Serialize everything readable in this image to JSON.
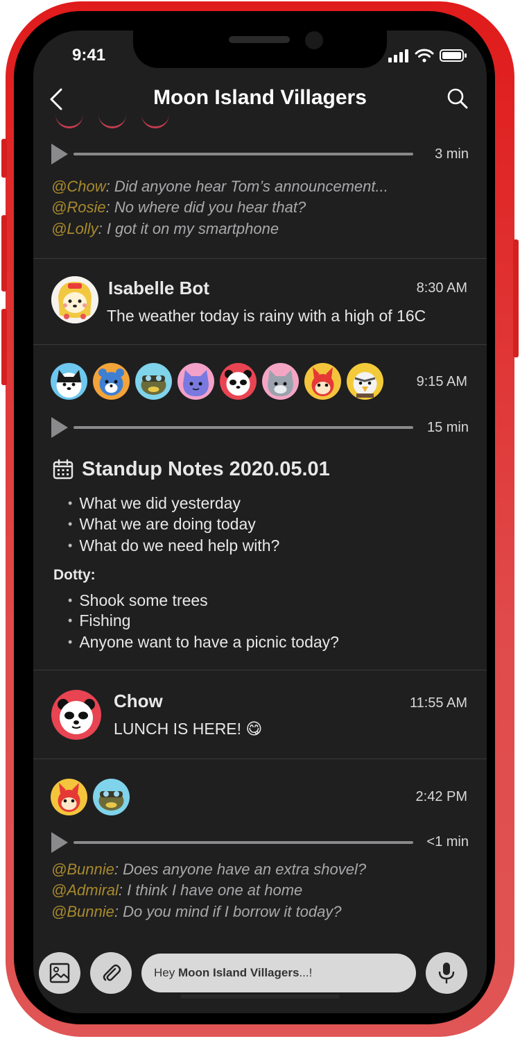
{
  "status": {
    "time": "9:41"
  },
  "header": {
    "title": "Moon Island Villagers",
    "back_icon": "chevron-left-icon",
    "search_icon": "search-icon"
  },
  "voice1": {
    "duration": "3 min",
    "lines": [
      {
        "mention": "@Chow",
        "text": ": Did anyone hear Tom’s announcement..."
      },
      {
        "mention": "@Rosie",
        "text": ": No where did you hear that?"
      },
      {
        "mention": "@Lolly",
        "text": ": I got it on my smartphone"
      }
    ]
  },
  "isabelle": {
    "name": "Isabelle Bot",
    "time": "8:30 AM",
    "text": "The weather today is rainy with a high of 16C"
  },
  "standup": {
    "time": "9:15 AM",
    "duration": "15 min",
    "title": "Standup Notes 2020.05.01",
    "agenda": [
      "What we did yesterday",
      "What we are doing today",
      "What do we need help with?"
    ],
    "section_label": "Dotty:",
    "notes": [
      "Shook some trees",
      "Fishing",
      "Anyone want to have a picnic today?"
    ]
  },
  "chow": {
    "name": "Chow",
    "time": "11:55 AM",
    "text": "LUNCH IS HERE! 😋"
  },
  "voice2": {
    "time": "2:42 PM",
    "duration": "<1 min",
    "lines": [
      {
        "mention": "@Bunnie",
        "text": ": Does anyone have an extra shovel?"
      },
      {
        "mention": "@Admiral",
        "text": ": I think I have one at home"
      },
      {
        "mention": "@Bunnie",
        "text": ": Do you mind if I borrow it today?"
      }
    ]
  },
  "composer": {
    "prefix": "Hey ",
    "group": "Moon Island Villagers",
    "suffix": "...!"
  },
  "colors": {
    "screen": "#1f1f20",
    "mention": "#a88a2c",
    "frame": "#e01b1b"
  }
}
